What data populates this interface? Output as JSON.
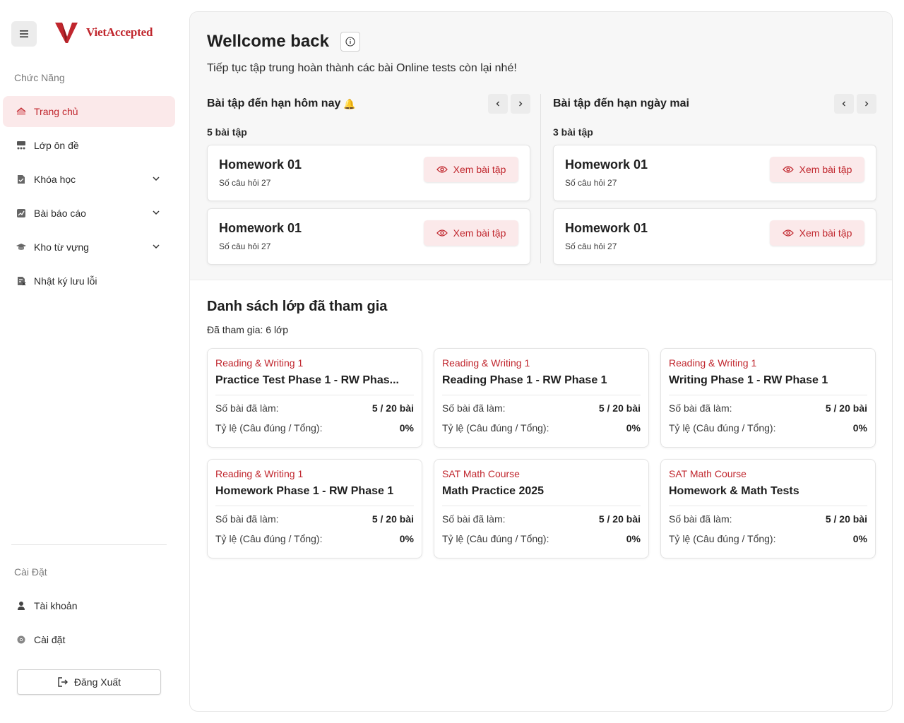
{
  "brand": {
    "name": "VietAccepted",
    "logo_letter": "V",
    "accent": "#c0262d"
  },
  "sidebar": {
    "functions_label": "Chức Năng",
    "items": [
      {
        "label": "Trang chủ",
        "icon": "home-icon",
        "active": true
      },
      {
        "label": "Lớp ôn đề",
        "icon": "classroom-icon"
      },
      {
        "label": "Khóa học",
        "icon": "course-icon",
        "expandable": true
      },
      {
        "label": "Bài báo cáo",
        "icon": "report-icon",
        "expandable": true
      },
      {
        "label": "Kho từ vựng",
        "icon": "vocabulary-icon",
        "expandable": true
      },
      {
        "label": "Nhật ký lưu lỗi",
        "icon": "error-log-icon"
      }
    ],
    "settings_label": "Cài Đặt",
    "settings_items": [
      {
        "label": "Tài khoản",
        "icon": "user-icon"
      },
      {
        "label": "Cài đặt",
        "icon": "gear-icon"
      }
    ],
    "logout_label": "Đăng Xuất"
  },
  "header": {
    "title": "Wellcome back",
    "subtitle": "Tiếp tục tập trung hoàn thành các bài Online tests còn lại nhé!"
  },
  "due_today": {
    "title": "Bài tập đến hạn hôm nay",
    "count": "5 bài tập",
    "items": [
      {
        "title": "Homework 01",
        "sub": "Số câu hỏi 27",
        "button": "Xem bài tập"
      },
      {
        "title": "Homework 01",
        "sub": "Số câu hỏi 27",
        "button": "Xem bài tập"
      }
    ]
  },
  "due_tomorrow": {
    "title": "Bài tập đến hạn ngày mai",
    "count": "3 bài tập",
    "items": [
      {
        "title": "Homework 01",
        "sub": "Số câu hỏi 27",
        "button": "Xem bài tập"
      },
      {
        "title": "Homework 01",
        "sub": "Số câu hỏi 27",
        "button": "Xem bài tập"
      }
    ]
  },
  "classes": {
    "title": "Danh sách lớp đã tham gia",
    "count": "Đã tham gia: 6 lớp",
    "done_label": "Số bài đã làm:",
    "ratio_label": "Tỷ lệ (Câu đúng / Tổng):",
    "items": [
      {
        "category": "Reading & Writing 1",
        "name": "Practice Test Phase 1 - RW Phas...",
        "done": "5 / 20 bài",
        "ratio": "0%"
      },
      {
        "category": "Reading & Writing 1",
        "name": "Reading Phase 1 - RW Phase 1",
        "done": "5 / 20 bài",
        "ratio": "0%"
      },
      {
        "category": "Reading & Writing 1",
        "name": "Writing Phase 1 - RW Phase 1",
        "done": "5 / 20 bài",
        "ratio": "0%"
      },
      {
        "category": "Reading & Writing 1",
        "name": "Homework Phase 1 - RW Phase 1",
        "done": "5 / 20 bài",
        "ratio": "0%"
      },
      {
        "category": "SAT Math Course",
        "name": "Math Practice 2025",
        "done": "5 / 20 bài",
        "ratio": "0%"
      },
      {
        "category": "SAT Math Course",
        "name": "Homework & Math Tests",
        "done": "5 / 20 bài",
        "ratio": "0%"
      }
    ]
  }
}
